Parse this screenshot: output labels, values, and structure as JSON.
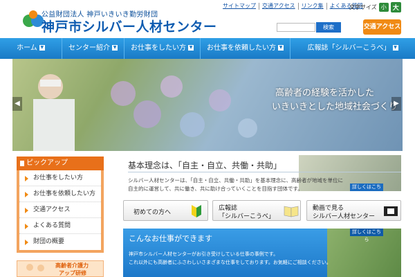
{
  "header": {
    "org_sub": "公益財団法人 神戸いきいき勤労財団",
    "org_main": "神戸市シルバー人材センター",
    "top_links": [
      "サイトマップ",
      "交通アクセス",
      "リンク集",
      "よくある質問"
    ],
    "font_size_label": "文字サイズ",
    "font_small": "小",
    "font_large": "大",
    "search_placeholder": "",
    "search_button": "検索",
    "access_button": "交通アクセス"
  },
  "nav": {
    "items": [
      {
        "label": "ホーム"
      },
      {
        "label": "センター紹介"
      },
      {
        "label": "お仕事をしたい方"
      },
      {
        "label": "お仕事を依頼したい方"
      },
      {
        "label": "広報誌「シルバーこうべ」"
      }
    ]
  },
  "hero": {
    "line1": "高齢者の経験を活かした",
    "line2": "いきいきとした地域社会づくり",
    "prev": "◀",
    "next": "▶"
  },
  "sidebar": {
    "pickup_title": "ピックアップ",
    "items": [
      "お仕事をしたい方",
      "お仕事を依頼したい方",
      "交通アクセス",
      "よくある質問",
      "財団の概要"
    ],
    "banner_line1": "高齢者介護力",
    "banner_line2": "アップ研修"
  },
  "concept": {
    "title": "基本理念は、「自主・自立、共働・共助」",
    "text1": "シルバー人材センターは、「自主・自立、共働・共助」を基本理念に、高齢者が地域を単位に",
    "text2": "自主的に運営して、共に働き、共に助け合っていくことを目指す団体です。",
    "more": "詳しくはこちら"
  },
  "quick_buttons": [
    {
      "label": "初めての方へ"
    },
    {
      "label1": "広報誌",
      "label2": "「シルバーこうべ」"
    },
    {
      "label1": "動画で見る",
      "label2": "シルバー人材センター"
    }
  ],
  "jobs": {
    "title": "こんなお仕事ができます",
    "text1": "神戸市シルバー人材センターがお引き受けしている仕事の事例です。",
    "text2": "これ以外にも高齢者にふさわしいさまざまな仕事をしております。お気軽にご相談ください。",
    "more": "詳しくはこちら"
  }
}
